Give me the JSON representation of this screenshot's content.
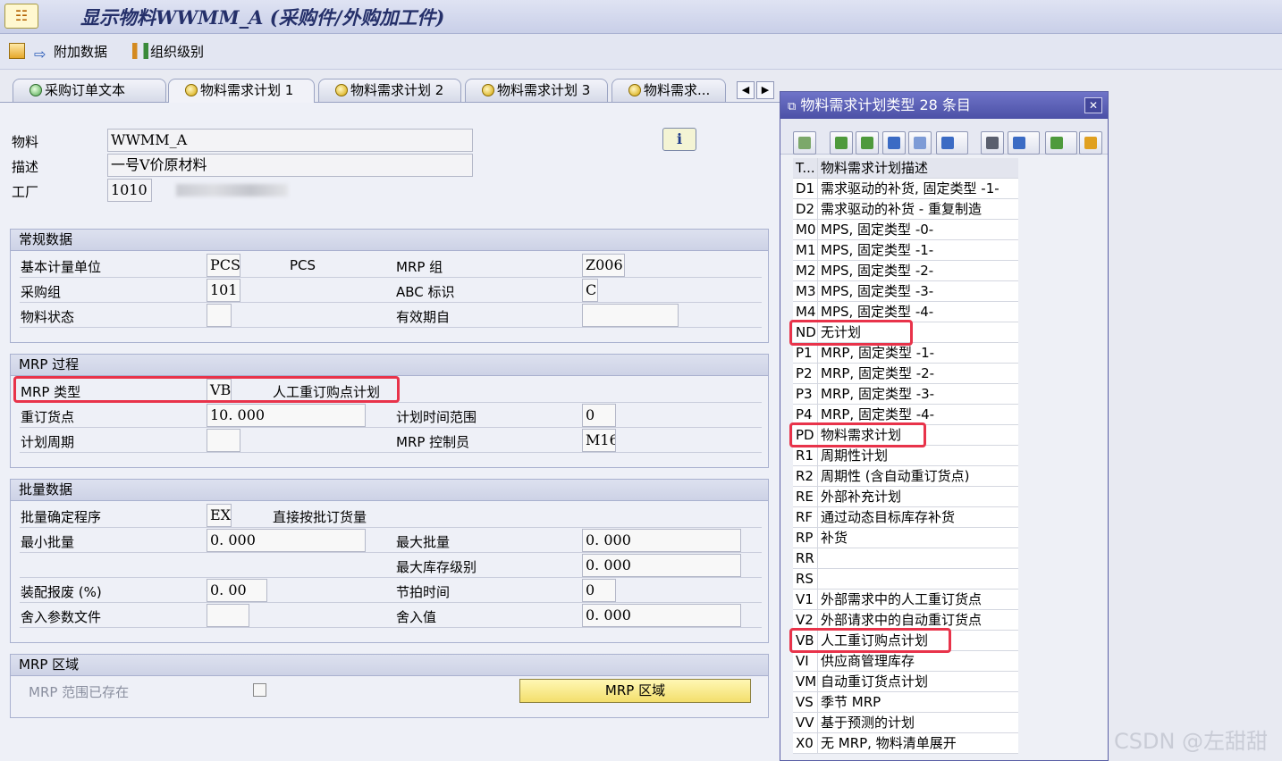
{
  "window": {
    "title": "显示物料WWMM_A (采购件/外购加工件)"
  },
  "toolbar": {
    "additional_data": "附加数据",
    "org_levels": "组织级别"
  },
  "tabs": [
    "采购订单文本",
    "物料需求计划 1",
    "物料需求计划 2",
    "物料需求计划 3",
    "物料需求..."
  ],
  "header": {
    "material_label": "物料",
    "material_value": "WWMM_A",
    "desc_label": "描述",
    "desc_value": "一号V价原材料",
    "plant_label": "工厂",
    "plant_value": "1010",
    "info_button": "i"
  },
  "general": {
    "title": "常规数据",
    "base_uom_label": "基本计量单位",
    "base_uom_value": "PCS",
    "base_uom_text": "PCS",
    "mrp_group_label": "MRP 组",
    "mrp_group_value": "Z006",
    "purch_group_label": "采购组",
    "purch_group_value": "101",
    "abc_label": "ABC 标识",
    "abc_value": "C",
    "status_label": "物料状态",
    "status_value": "",
    "valid_from_label": "有效期自",
    "valid_from_value": ""
  },
  "mrp_process": {
    "title": "MRP 过程",
    "mrp_type_label": "MRP 类型",
    "mrp_type_value": "VB",
    "mrp_type_text": "人工重订购点计划",
    "reorder_label": "重订货点",
    "reorder_value": "10. 000",
    "time_fence_label": "计划时间范围",
    "time_fence_value": "0",
    "cycle_label": "计划周期",
    "cycle_value": "",
    "controller_label": "MRP 控制员",
    "controller_value": "M16"
  },
  "lot_size": {
    "title": "批量数据",
    "procedure_label": "批量确定程序",
    "procedure_value": "EX",
    "procedure_text": "直接按批订货量",
    "min_label": "最小批量",
    "min_value": "0. 000",
    "max_label": "最大批量",
    "max_value": "0. 000",
    "max_stock_label": "最大库存级别",
    "max_stock_value": "0. 000",
    "scrap_label": "装配报废 (%)",
    "scrap_value": "0. 00",
    "takt_label": "节拍时间",
    "takt_value": "0",
    "rounding_profile_label": "舍入参数文件",
    "rounding_profile_value": "",
    "rounding_value_label": "舍入值",
    "rounding_value_value": "0. 000"
  },
  "mrp_area": {
    "title": "MRP 区域",
    "exists_label": "MRP 范围已存在",
    "button": "MRP 区域"
  },
  "popup": {
    "title": "物料需求计划类型 28 条目",
    "col1": "T...",
    "col2": "物料需求计划描述",
    "rows": [
      {
        "code": "D1",
        "desc": "需求驱动的补货, 固定类型 -1-"
      },
      {
        "code": "D2",
        "desc": "需求驱动的补货 - 重复制造"
      },
      {
        "code": "M0",
        "desc": "MPS, 固定类型 -0-"
      },
      {
        "code": "M1",
        "desc": "MPS, 固定类型 -1-"
      },
      {
        "code": "M2",
        "desc": "MPS, 固定类型 -2-"
      },
      {
        "code": "M3",
        "desc": "MPS, 固定类型 -3-"
      },
      {
        "code": "M4",
        "desc": "MPS, 固定类型 -4-"
      },
      {
        "code": "ND",
        "desc": "无计划"
      },
      {
        "code": "P1",
        "desc": "MRP, 固定类型 -1-"
      },
      {
        "code": "P2",
        "desc": "MRP, 固定类型 -2-"
      },
      {
        "code": "P3",
        "desc": "MRP, 固定类型 -3-"
      },
      {
        "code": "P4",
        "desc": "MRP, 固定类型 -4-"
      },
      {
        "code": "PD",
        "desc": "物料需求计划"
      },
      {
        "code": "R1",
        "desc": "周期性计划"
      },
      {
        "code": "R2",
        "desc": "周期性 (含自动重订货点)"
      },
      {
        "code": "RE",
        "desc": "外部补充计划"
      },
      {
        "code": "RF",
        "desc": "通过动态目标库存补货"
      },
      {
        "code": "RP",
        "desc": "补货"
      },
      {
        "code": "RR",
        "desc": ""
      },
      {
        "code": "RS",
        "desc": ""
      },
      {
        "code": "V1",
        "desc": "外部需求中的人工重订货点"
      },
      {
        "code": "V2",
        "desc": "外部请求中的自动重订货点"
      },
      {
        "code": "VB",
        "desc": "人工重订购点计划"
      },
      {
        "code": "VI",
        "desc": "供应商管理库存"
      },
      {
        "code": "VM",
        "desc": "自动重订货点计划"
      },
      {
        "code": "VS",
        "desc": "季节 MRP"
      },
      {
        "code": "VV",
        "desc": "基于预测的计划"
      },
      {
        "code": "X0",
        "desc": "无 MRP, 物料清单展开"
      }
    ]
  },
  "watermark": "CSDN @左甜甜",
  "colors": {
    "highlight": "#e8334a",
    "title_bar": "#4b50a6",
    "button_yellow": "#f3df6c"
  }
}
